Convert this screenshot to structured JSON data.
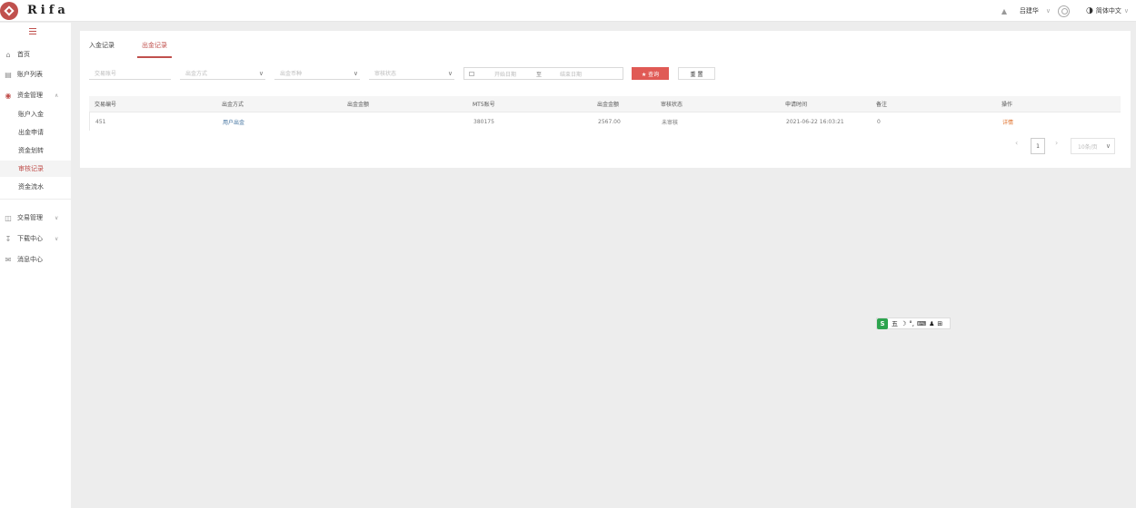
{
  "app": {
    "logo_text": "Rifa"
  },
  "topbar": {
    "user_name": "吕建华",
    "language": "简体中文",
    "icons": [
      "bell-icon",
      "chevron-down-icon",
      "avatar-icon",
      "globe-icon"
    ]
  },
  "sidebar": {
    "items": [
      {
        "label": "首页",
        "icon": "home-icon"
      },
      {
        "label": "账户列表",
        "icon": "list-icon"
      },
      {
        "label": "资金管理",
        "icon": "money-icon",
        "expanded": true
      },
      {
        "label": "交易管理",
        "icon": "chart-icon"
      },
      {
        "label": "下载中心",
        "icon": "download-icon"
      },
      {
        "label": "消息中心",
        "icon": "mail-icon"
      }
    ],
    "sub_items": [
      {
        "label": "账户入金",
        "active": false
      },
      {
        "label": "出金申请",
        "active": false
      },
      {
        "label": "资金划转",
        "active": false
      },
      {
        "label": "审核记录",
        "active": true
      },
      {
        "label": "资金流水",
        "active": false
      }
    ]
  },
  "tabs": [
    {
      "label": "入金记录",
      "active": false
    },
    {
      "label": "出金记录",
      "active": true
    }
  ],
  "filters": {
    "account_placeholder": "交易账号",
    "withdraw_method_placeholder": "出金方式",
    "currency_placeholder": "出金币种",
    "status_placeholder": "审核状态",
    "start_date_placeholder": "开始日期",
    "date_separator": "至",
    "end_date_placeholder": "结束日期",
    "search_label": "★ 查询",
    "reset_label": "重 置"
  },
  "table": {
    "headers": [
      "交易编号",
      "出金方式",
      "出金金额",
      "MT5账号",
      "出金金额",
      "审核状态",
      "申请时间",
      "备注",
      "操作"
    ],
    "rows": [
      [
        "451",
        "用户出金",
        "",
        "380175",
        "2567.00",
        "未审核",
        "2021-06-22 16:03:21",
        "0",
        "详情"
      ]
    ]
  },
  "pagination": {
    "current_page": "1",
    "page_size_label": "10条/页"
  },
  "ime_toolbar": {
    "logo": "S",
    "items": [
      "五",
      "☽",
      "°,",
      "⌨",
      "♟",
      "⊞"
    ]
  },
  "colors": {
    "accent": "#c0504d",
    "search_button": "#e05a55",
    "link": "#3c6e9c",
    "operation": "#e0712b",
    "background": "#ededed"
  }
}
